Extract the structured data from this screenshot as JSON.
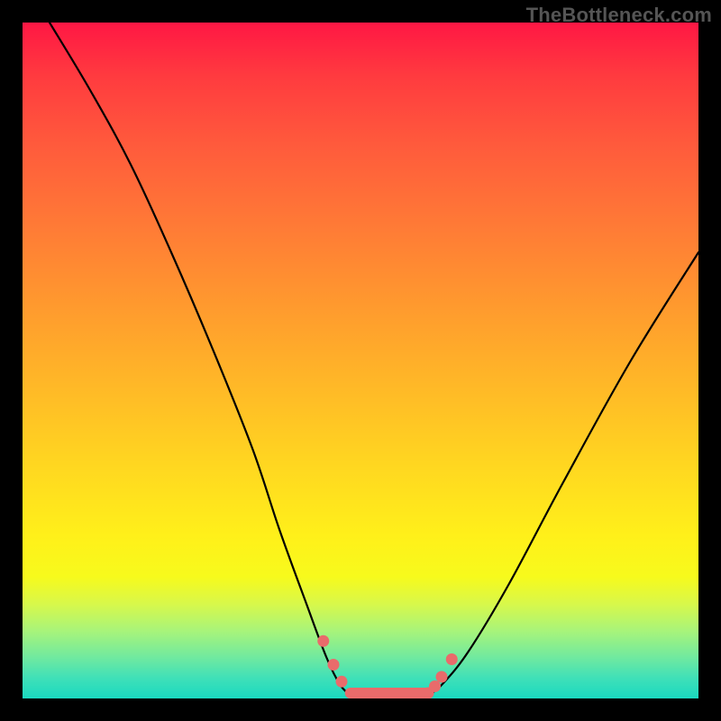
{
  "watermark": "TheBottleneck.com",
  "chart_data": {
    "type": "line",
    "title": "",
    "xlabel": "",
    "ylabel": "",
    "xlim": [
      0,
      100
    ],
    "ylim": [
      0,
      100
    ],
    "grid": false,
    "legend": false,
    "series": [
      {
        "name": "left-branch",
        "x": [
          4,
          10,
          16,
          22,
          28,
          34,
          38,
          42,
          45,
          47,
          48.5
        ],
        "y": [
          100,
          90,
          79,
          66,
          52,
          37,
          25,
          14,
          6,
          2,
          0.5
        ]
      },
      {
        "name": "flat-bottom",
        "x": [
          48.5,
          50,
          52,
          54,
          56,
          58,
          60
        ],
        "y": [
          0.5,
          0.2,
          0.1,
          0.1,
          0.1,
          0.2,
          0.5
        ]
      },
      {
        "name": "right-branch",
        "x": [
          60,
          62,
          66,
          72,
          80,
          90,
          100
        ],
        "y": [
          0.5,
          2,
          7,
          17,
          32,
          50,
          66
        ]
      }
    ],
    "markers": [
      {
        "name": "bead-left-1",
        "x": 44.5,
        "y": 8.5
      },
      {
        "name": "bead-left-2",
        "x": 46.0,
        "y": 5.0
      },
      {
        "name": "bead-left-3",
        "x": 47.2,
        "y": 2.5
      },
      {
        "name": "bead-right-1",
        "x": 60.0,
        "y": 0.8
      },
      {
        "name": "bead-right-2",
        "x": 61.0,
        "y": 1.8
      },
      {
        "name": "bead-right-3",
        "x": 62.0,
        "y": 3.2
      },
      {
        "name": "bead-right-4",
        "x": 63.5,
        "y": 5.8
      }
    ],
    "flat_segment": {
      "x0": 48.5,
      "x1": 60,
      "y": 0.8
    },
    "colors": {
      "curve": "#000000",
      "beads": "#e96b6b",
      "bg_top": "#ff1744",
      "bg_bottom": "#1ad9c0"
    }
  }
}
